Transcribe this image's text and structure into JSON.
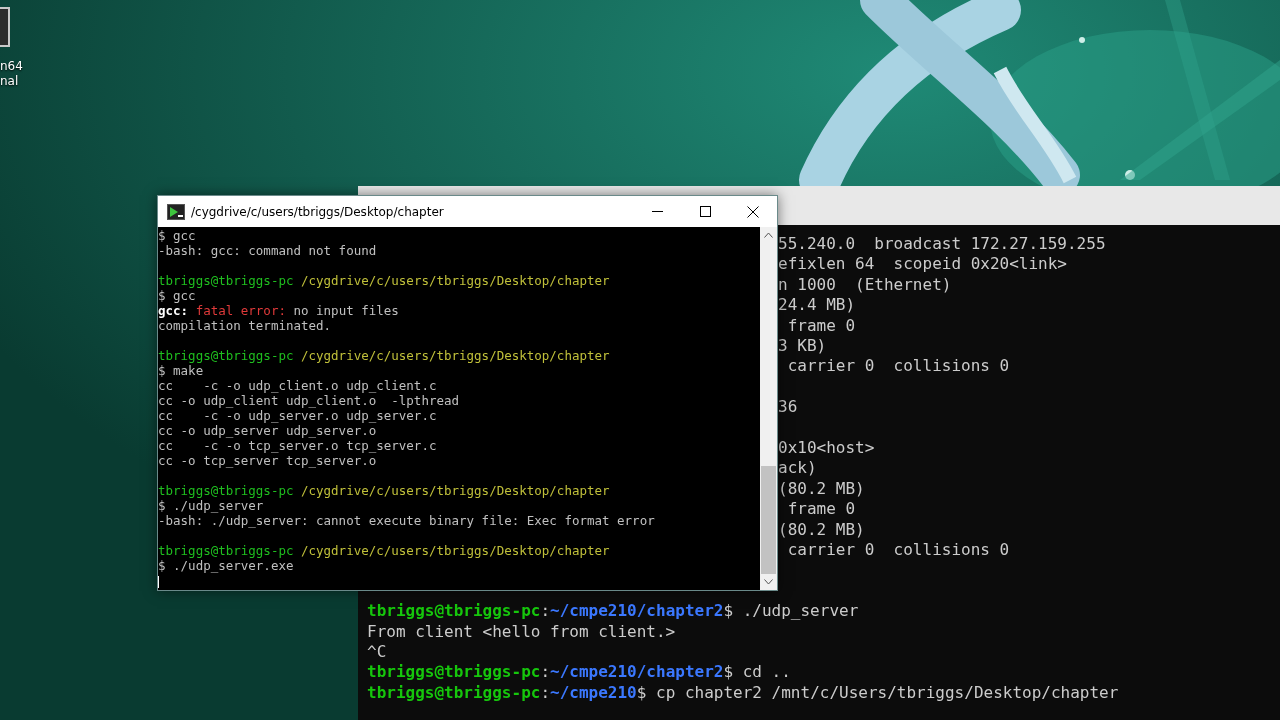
{
  "desktop_icon": {
    "label_lines": [
      "n64",
      "nal"
    ]
  },
  "back_terminal": {
    "upper_blocks": [
      [
        {
          "segments": [
            {
              "text": "55.240.0  broadcast 172.27.159.255",
              "kind": "plain"
            }
          ]
        },
        {
          "segments": [
            {
              "text": "efixlen 64  scopeid 0x20<link>",
              "kind": "plain"
            }
          ]
        },
        {
          "segments": [
            {
              "text": "n 1000  (Ethernet)",
              "kind": "plain"
            }
          ]
        },
        {
          "segments": [
            {
              "text": "24.4 MB)",
              "kind": "plain"
            }
          ]
        },
        {
          "segments": [
            {
              "text": " frame 0",
              "kind": "plain"
            }
          ]
        },
        {
          "segments": [
            {
              "text": "3 KB)",
              "kind": "plain"
            }
          ]
        },
        {
          "segments": [
            {
              "text": " carrier 0  collisions 0",
              "kind": "plain"
            }
          ]
        }
      ],
      [
        {
          "segments": [
            {
              "text": "36",
              "kind": "plain"
            }
          ]
        }
      ],
      [
        {
          "segments": [
            {
              "text": "0x10<host>",
              "kind": "plain"
            }
          ]
        },
        {
          "segments": [
            {
              "text": "ack)",
              "kind": "plain"
            }
          ]
        },
        {
          "segments": [
            {
              "text": "(80.2 MB)",
              "kind": "plain"
            }
          ]
        },
        {
          "segments": [
            {
              "text": " frame 0",
              "kind": "plain"
            }
          ]
        },
        {
          "segments": [
            {
              "text": "(80.2 MB)",
              "kind": "plain"
            }
          ]
        },
        {
          "segments": [
            {
              "text": " carrier 0  collisions 0",
              "kind": "plain"
            }
          ]
        }
      ]
    ],
    "lower_lines": [
      {
        "segments": [
          {
            "text": "tbriggs@tbriggs-pc",
            "kind": "user"
          },
          {
            "text": ":",
            "kind": "plain"
          },
          {
            "text": "~/cmpe210/chapter2",
            "kind": "path"
          },
          {
            "text": "$ ./udp_server",
            "kind": "plain"
          }
        ]
      },
      {
        "segments": [
          {
            "text": "From client <hello from client.>",
            "kind": "plain"
          }
        ]
      },
      {
        "segments": [
          {
            "text": "^C",
            "kind": "plain"
          }
        ]
      },
      {
        "segments": [
          {
            "text": "tbriggs@tbriggs-pc",
            "kind": "user"
          },
          {
            "text": ":",
            "kind": "plain"
          },
          {
            "text": "~/cmpe210/chapter2",
            "kind": "path"
          },
          {
            "text": "$ cd ..",
            "kind": "plain"
          }
        ]
      },
      {
        "segments": [
          {
            "text": "tbriggs@tbriggs-pc",
            "kind": "user"
          },
          {
            "text": ":",
            "kind": "plain"
          },
          {
            "text": "~/cmpe210",
            "kind": "path"
          },
          {
            "text": "$ cp chapter2 /mnt/c/Users/tbriggs/Desktop/chapter",
            "kind": "plain"
          }
        ]
      }
    ]
  },
  "front_terminal": {
    "title": "/cygdrive/c/users/tbriggs/Desktop/chapter",
    "blocks": [
      [
        {
          "segments": [
            {
              "text": "$ gcc",
              "kind": "plain"
            }
          ]
        },
        {
          "segments": [
            {
              "text": "-bash: gcc: command not found",
              "kind": "plain"
            }
          ]
        }
      ],
      [
        {
          "segments": [
            {
              "text": "tbriggs@tbriggs-pc",
              "kind": "user"
            },
            {
              "text": " /cygdrive/c/users/tbriggs/Desktop/chapter",
              "kind": "path"
            }
          ]
        },
        {
          "segments": [
            {
              "text": "$ gcc",
              "kind": "plain"
            }
          ]
        },
        {
          "segments": [
            {
              "text": "gcc: ",
              "kind": "bold"
            },
            {
              "text": "fatal error:",
              "kind": "error"
            },
            {
              "text": " no input files",
              "kind": "plain"
            }
          ]
        },
        {
          "segments": [
            {
              "text": "compilation terminated.",
              "kind": "plain"
            }
          ]
        }
      ],
      [
        {
          "segments": [
            {
              "text": "tbriggs@tbriggs-pc",
              "kind": "user"
            },
            {
              "text": " /cygdrive/c/users/tbriggs/Desktop/chapter",
              "kind": "path"
            }
          ]
        },
        {
          "segments": [
            {
              "text": "$ make",
              "kind": "plain"
            }
          ]
        },
        {
          "segments": [
            {
              "text": "cc    -c -o udp_client.o udp_client.c",
              "kind": "plain"
            }
          ]
        },
        {
          "segments": [
            {
              "text": "cc -o udp_client udp_client.o  -lpthread",
              "kind": "plain"
            }
          ]
        },
        {
          "segments": [
            {
              "text": "cc    -c -o udp_server.o udp_server.c",
              "kind": "plain"
            }
          ]
        },
        {
          "segments": [
            {
              "text": "cc -o udp_server udp_server.o",
              "kind": "plain"
            }
          ]
        },
        {
          "segments": [
            {
              "text": "cc    -c -o tcp_server.o tcp_server.c",
              "kind": "plain"
            }
          ]
        },
        {
          "segments": [
            {
              "text": "cc -o tcp_server tcp_server.o",
              "kind": "plain"
            }
          ]
        }
      ],
      [
        {
          "segments": [
            {
              "text": "tbriggs@tbriggs-pc",
              "kind": "user"
            },
            {
              "text": " /cygdrive/c/users/tbriggs/Desktop/chapter",
              "kind": "path"
            }
          ]
        },
        {
          "segments": [
            {
              "text": "$ ./udp_server",
              "kind": "plain"
            }
          ]
        },
        {
          "segments": [
            {
              "text": "-bash: ./udp_server: cannot execute binary file: Exec format error",
              "kind": "plain"
            }
          ]
        }
      ],
      [
        {
          "segments": [
            {
              "text": "tbriggs@tbriggs-pc",
              "kind": "user"
            },
            {
              "text": " /cygdrive/c/users/tbriggs/Desktop/chapter",
              "kind": "path"
            }
          ]
        },
        {
          "segments": [
            {
              "text": "$ ./udp_server.exe",
              "kind": "plain"
            }
          ]
        }
      ]
    ]
  }
}
